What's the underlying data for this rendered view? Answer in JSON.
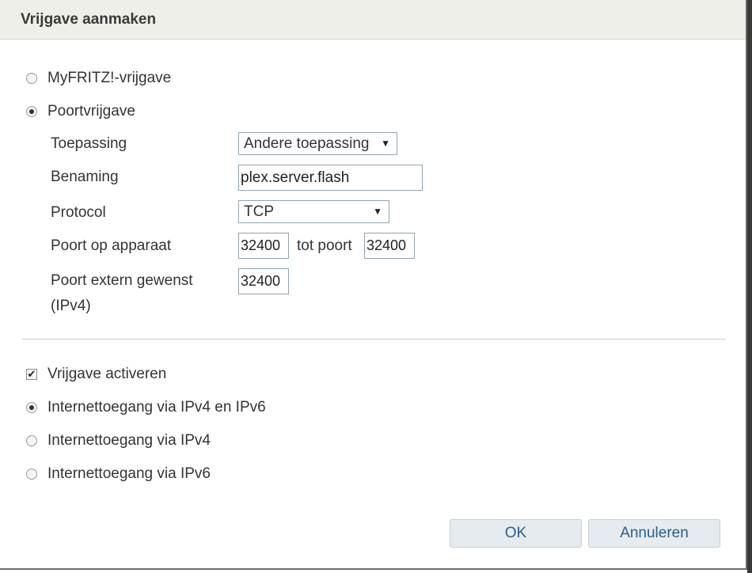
{
  "dialog": {
    "title": "Vrijgave aanmaken"
  },
  "share_type": {
    "options": [
      {
        "label": "MyFRITZ!-vrijgave",
        "selected": false
      },
      {
        "label": "Poortvrijgave",
        "selected": true
      }
    ]
  },
  "form": {
    "application": {
      "label": "Toepassing",
      "value": "Andere toepassing"
    },
    "name": {
      "label": "Benaming",
      "value": "plex.server.flash"
    },
    "protocol": {
      "label": "Protocol",
      "value": "TCP"
    },
    "port_device": {
      "label": "Poort op apparaat",
      "from": "32400",
      "to_label": "tot poort",
      "to": "32400"
    },
    "port_external": {
      "label_line1": "Poort extern gewenst",
      "label_line2": "(IPv4)",
      "value": "32400"
    }
  },
  "activation": {
    "label": "Vrijgave activeren",
    "checked": true
  },
  "internet_access": {
    "options": [
      {
        "label": "Internettoegang via IPv4 en IPv6",
        "selected": true
      },
      {
        "label": "Internettoegang via IPv4",
        "selected": false
      },
      {
        "label": "Internettoegang via IPv6",
        "selected": false
      }
    ]
  },
  "buttons": {
    "ok": "OK",
    "cancel": "Annuleren"
  },
  "colors": {
    "titlebar_bg": "#efefea",
    "button_text": "#2b5f8a",
    "input_border": "#8fa5b0"
  },
  "icons": {
    "dropdown": "triangle-down",
    "check": "check-mark"
  }
}
